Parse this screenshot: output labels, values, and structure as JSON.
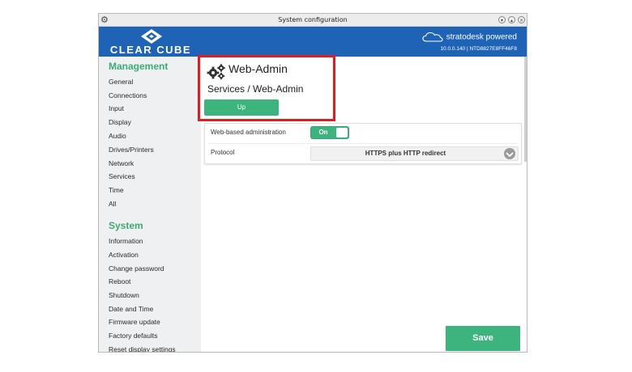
{
  "window": {
    "title": "System configuration"
  },
  "header": {
    "brand": "CLEAR CUBE",
    "powered_by": "stratodesk powered",
    "device_info": "10.0.0.140 | NTD8827E8FF46F8"
  },
  "sidebar": {
    "management_title": "Management",
    "management_items": [
      "General",
      "Connections",
      "Input",
      "Display",
      "Audio",
      "Drives/Printers",
      "Network",
      "Services",
      "Time",
      "All"
    ],
    "system_title": "System",
    "system_items": [
      "Information",
      "Activation",
      "Change password",
      "Reboot",
      "Shutdown",
      "Date and Time",
      "Firmware update",
      "Factory defaults",
      "Reset display settings"
    ]
  },
  "main": {
    "page_title": "Web-Admin",
    "breadcrumb": "Services / Web-Admin",
    "up_button": "Up",
    "settings": {
      "web_admin_label": "Web-based administration",
      "web_admin_toggle": "On",
      "protocol_label": "Protocol",
      "protocol_value": "HTTPS plus HTTP redirect"
    },
    "save_button": "Save"
  },
  "icons": {
    "app": "gears-icon",
    "page": "gears-icon",
    "logo": "clearcube-logo",
    "cloud": "stratodesk-cloud-icon",
    "select": "chevron-down-icon"
  },
  "colors": {
    "header_blue": "#1e63b6",
    "accent_green": "#3db37e",
    "highlight_red": "#e01b24",
    "sidebar_bg": "#eef0f1"
  }
}
